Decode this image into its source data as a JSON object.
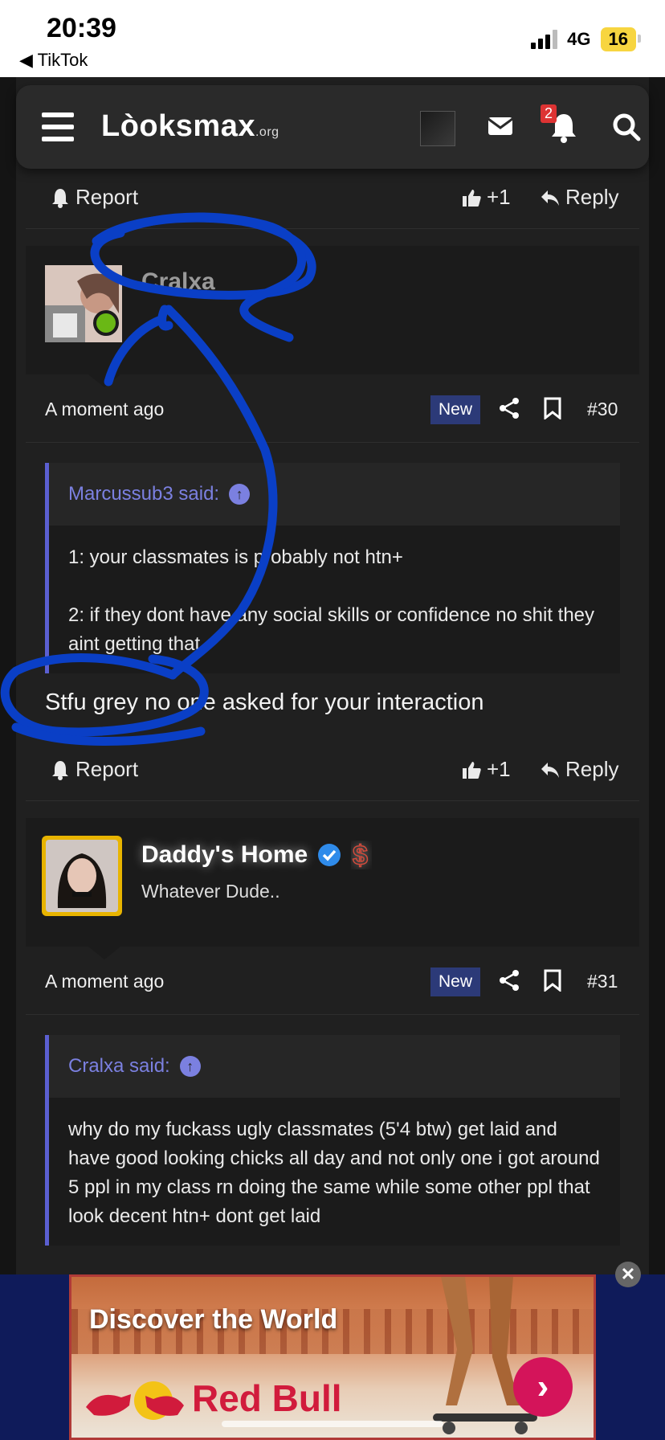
{
  "status_bar": {
    "time": "20:39",
    "back_app": "◀ TikTok",
    "network": "4G",
    "battery": "16"
  },
  "header": {
    "logo": "Lòoksmax",
    "logo_suffix": ".org",
    "notification_count": "2"
  },
  "post_actions": {
    "report": "Report",
    "like_count": "+1",
    "reply": "Reply"
  },
  "posts": [
    {
      "username": "Cralxa",
      "user_title": "",
      "time": "A moment ago",
      "badge": "New",
      "post_number": "#30",
      "quote_author": "Marcussub3 said:",
      "quote_lines": [
        "1: your classmates is probably not htn+",
        "2: if they dont have any social skills or confidence no shit they aint getting that"
      ],
      "message": "Stfu grey no one asked for your interaction"
    },
    {
      "username": "Daddy's Home",
      "user_title": "Whatever Dude..",
      "time": "A moment ago",
      "badge": "New",
      "post_number": "#31",
      "quote_author": "Cralxa said:",
      "quote_lines": [
        "why do my fuckass ugly classmates (5'4 btw) get laid and have good looking chicks all day and not only one i got around 5 ppl in my class rn doing the same while some other ppl that look decent htn+ dont get laid"
      ]
    }
  ],
  "ad": {
    "title": "Discover the World",
    "brand": "Red Bull",
    "close": "✕"
  },
  "colors": {
    "accent": "#5b5fd1",
    "online": "#6ab815",
    "badge_new": "#2c3a78",
    "scribble": "#0a3fc6"
  }
}
